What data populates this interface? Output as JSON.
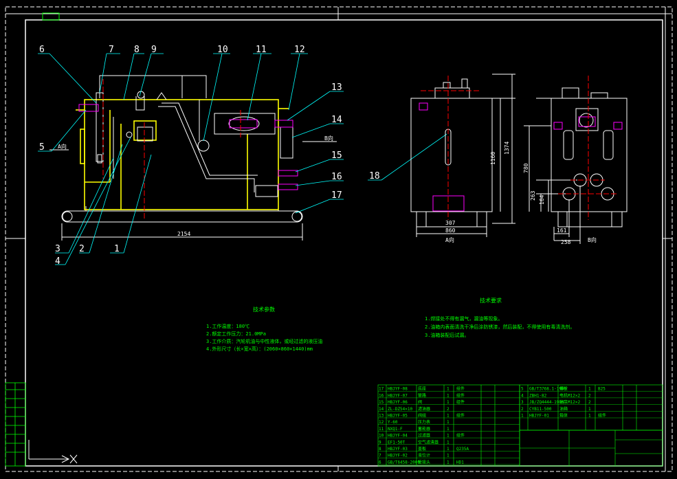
{
  "drawing": {
    "tag_top_left": "",
    "side_view_label": "",
    "view_a_label": "A向",
    "view_b_label": "B向",
    "side_arrow_a": "A向",
    "side_arrow_b": "B向",
    "dims": {
      "side_length": "2154",
      "a_width_inner": "307",
      "a_width_outer": "860",
      "a_height_inner": "1160",
      "a_height_outer": "1374",
      "b_h1": "780",
      "b_h2": "263",
      "b_h3": "164",
      "b_w1": "161",
      "b_w2": "258"
    },
    "callouts": [
      "1",
      "2",
      "3",
      "4",
      "5",
      "6",
      "7",
      "8",
      "9",
      "10",
      "11",
      "12",
      "13",
      "14",
      "15",
      "16",
      "17",
      "18"
    ]
  },
  "tech_params": {
    "title": "技术参数",
    "lines": [
      "1.工作温度：180℃",
      "2.额定工作压力：21.0MPa",
      "3.工作介质：汽轮机油与中性液体，或经过滤的液压油",
      "4.外形尺寸（长×宽×高）：(2060×860×1440)mm"
    ]
  },
  "tech_reqs": {
    "title": "技术要求",
    "lines": [
      "1.焊接处不得有漏气，漏油等现象。",
      "2.油箱内表面清洗干净后涂防锈漆，然后装配，不得使用有毒清洗剂。",
      "3.油箱装配后试漏。"
    ]
  },
  "parts_left": [
    {
      "no": "17",
      "code": "HBJYF-08",
      "name": "底座",
      "qty": "1",
      "mat": "组件"
    },
    {
      "no": "16",
      "code": "HBJYF-07",
      "name": "管路",
      "qty": "1",
      "mat": "组件"
    },
    {
      "no": "15",
      "code": "HBJYF-06",
      "name": "阀",
      "qty": "1",
      "mat": "组件"
    },
    {
      "no": "14",
      "code": "ZL-DZ54×10",
      "name": "滤油器",
      "qty": "2",
      "mat": ""
    },
    {
      "no": "13",
      "code": "HBJYF-05",
      "name": "阀组",
      "qty": "1",
      "mat": "组件"
    },
    {
      "no": "12",
      "code": "Y-60",
      "name": "压力表",
      "qty": "1",
      "mat": ""
    },
    {
      "no": "11",
      "code": "NXQ1-F",
      "name": "蓄能器",
      "qty": "1",
      "mat": ""
    },
    {
      "no": "10",
      "code": "HBJYF-04",
      "name": "过滤器",
      "qty": "1",
      "mat": "组件"
    },
    {
      "no": "9",
      "code": "EF1-50T",
      "name": "空气滤清器",
      "qty": "1",
      "mat": ""
    },
    {
      "no": "8",
      "code": "HBJYF-03",
      "name": "盖板",
      "qty": "1",
      "mat": "Q235A"
    },
    {
      "no": "7",
      "code": "HBJYF-02",
      "name": "液位计",
      "qty": "1",
      "mat": ""
    },
    {
      "no": "6",
      "code": "GB/T6458-2000",
      "name": "管接头",
      "qty": "1",
      "mat": "HD1"
    }
  ],
  "parts_right": [
    {
      "no": "5",
      "code": "GB/T3768.1-1999",
      "name": "螺栓",
      "qty": "1",
      "mat": "B25"
    },
    {
      "no": "4",
      "code": "ZBH1-82",
      "name": "电机M12×2",
      "qty": "2",
      "mat": ""
    },
    {
      "no": "3",
      "code": "JB/ZQ4444-1986",
      "name": "油泵M12×2",
      "qty": "2",
      "mat": ""
    },
    {
      "no": "2",
      "code": "CYB11-500",
      "name": "油箱",
      "qty": "1",
      "mat": ""
    },
    {
      "no": "1",
      "code": "HBJYF-01",
      "name": "箱体",
      "qty": "1",
      "mat": "组件"
    }
  ],
  "title_block": {
    "drawing_name": "",
    "code": "",
    "scale": ""
  },
  "colors": {
    "background": "#000000",
    "frame": "#ffffff",
    "tank": "#ffff00",
    "callout_line": "#00ffff",
    "center_line": "#ff0000",
    "text_green": "#00ff00"
  }
}
